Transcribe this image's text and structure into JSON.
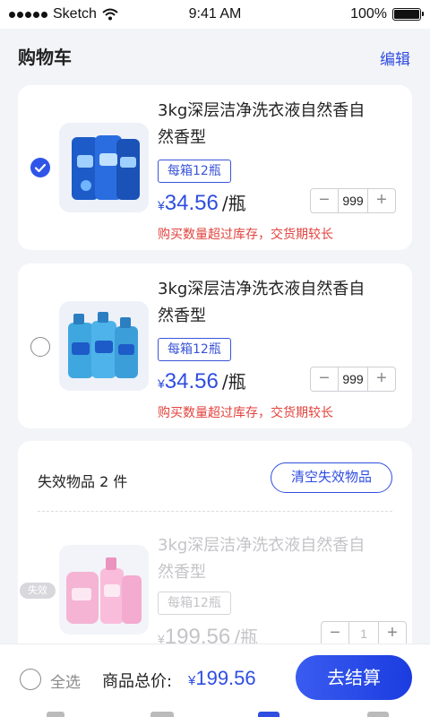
{
  "status_bar": {
    "carrier": "Sketch",
    "time": "9:41 AM",
    "battery": "100%"
  },
  "header": {
    "title": "购物车",
    "edit_label": "编辑"
  },
  "cart_items": [
    {
      "name_line1": "3kg深层洁净洗衣液自然香自",
      "name_line2": "然香型",
      "tag": "每箱12瓶",
      "currency": "¥",
      "price": "34.56",
      "unit": "/瓶",
      "quantity": "999",
      "warning": "购买数量超过库存，交货期较长",
      "checked": true,
      "image": "blue-detergent-pouches"
    },
    {
      "name_line1": "3kg深层洁净洗衣液自然香自",
      "name_line2": "然香型",
      "tag": "每箱12瓶",
      "currency": "¥",
      "price": "34.56",
      "unit": "/瓶",
      "quantity": "999",
      "warning": "购买数量超过库存，交货期较长",
      "checked": false,
      "image": "blue-detergent-bottles"
    }
  ],
  "invalid_section": {
    "title": "失效物品 2 件",
    "clear_label": "清空失效物品",
    "badge": "失效",
    "item": {
      "name_line1": "3kg深层洁净洗衣液自然香自",
      "name_line2": "然香型",
      "tag": "每箱12瓶",
      "currency": "¥",
      "price": "199.56",
      "unit": "/瓶",
      "quantity": "1",
      "image": "pink-detergent-bottles"
    }
  },
  "bottom_bar": {
    "select_all": "全选",
    "total_label": "商品总价:",
    "currency": "¥",
    "total": "199.56",
    "checkout_label": "去结算"
  },
  "colors": {
    "accent": "#2f4de0",
    "warning": "#e2423d",
    "background": "#f3f4f8"
  },
  "icons": {
    "signal": "signal-dots-icon",
    "wifi": "wifi-icon",
    "battery": "battery-icon",
    "checked": "check-circle-icon",
    "unchecked": "empty-circle-icon",
    "minus": "minus-icon",
    "plus": "plus-icon"
  }
}
